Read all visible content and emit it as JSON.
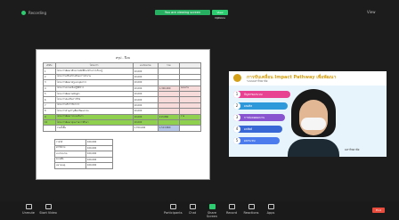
{
  "topbar": {
    "recording_label": "Recording",
    "share_banner": "You are viewing screen",
    "share_button": "View Options",
    "view_label": "View"
  },
  "document": {
    "title": "สรุป - ปีงบ",
    "headers": [
      "ลำดับ",
      "โครงการ",
      "งบประมาณ",
      "รวม",
      ""
    ],
    "rows": [
      {
        "no": "1",
        "name": "โครงการพัฒนาศักยภาพนักศึกษาด้านการเรียนรู้",
        "budget": "10,000",
        "sum": "",
        "note": ""
      },
      {
        "no": "2",
        "name": "โครงการเสริมสร้างทักษะการทำงาน",
        "budget": "10,000",
        "sum": "",
        "note": ""
      },
      {
        "no": "3",
        "name": "โครงการพัฒนาครูและบุคลากร",
        "budget": "10,000",
        "sum": "",
        "note": ""
      },
      {
        "no": "4",
        "name": "โครงการอบรมเชิงปฏิบัติการ",
        "budget": "10,000",
        "sum": "1,300,000",
        "note": "แผนงาน"
      },
      {
        "no": "5",
        "name": "โครงการพัฒนาหลักสูตร",
        "budget": "10,000",
        "sum": "",
        "note": ""
      },
      {
        "no": "6",
        "name": "โครงการส่งเสริมการวิจัย",
        "budget": "10,000",
        "sum": "",
        "note": ""
      },
      {
        "no": "7",
        "name": "โครงการบริการวิชาการ",
        "budget": "10,000",
        "sum": "",
        "note": ""
      },
      {
        "no": "8",
        "name": "โครงการทำนุบำรุงศิลปวัฒนธรรม",
        "budget": "10,000",
        "sum": "",
        "note": ""
      },
      {
        "no": "9",
        "name": "โครงการพัฒนาระบบบริหาร",
        "budget": "10,000",
        "sum": "213,860",
        "note": "รวม"
      },
      {
        "no": "10",
        "name": "โครงการพัฒนาคุณภาพการศึกษา",
        "budget": "10,000",
        "sum": "",
        "note": ""
      }
    ],
    "total_label": "รวมทั้งสิ้น",
    "total_budget": "1,700,000",
    "total_sum": "1,513,860",
    "low_rows": [
      {
        "label": "รายได้",
        "value": "100,000"
      },
      {
        "label": "ค่าใช้จ่าย",
        "value": "100,000"
      },
      {
        "label": "งบประมาณ",
        "value": "100,000"
      },
      {
        "label": "คงเหลือ",
        "value": "100,000"
      },
      {
        "label": "หมายเหตุ",
        "value": "100,000"
      }
    ]
  },
  "video": {
    "title": "การขับเคลื่อน Impact Pathway เพื่อพัฒนา",
    "subtitle": "ระบบมหาวิทยาลัย",
    "pills": [
      {
        "num": "1",
        "text": "ปัญหาของระบบ"
      },
      {
        "num": "2",
        "text": "ผลผลิต"
      },
      {
        "num": "3",
        "text": "การต่อยอดผลงาน"
      },
      {
        "num": "4",
        "text": "ผลลัพธ์"
      },
      {
        "num": "5",
        "text": "ผลกระทบ"
      }
    ],
    "footer": "มหาวิทยาลัย"
  },
  "toolbar": {
    "items": [
      "Unmute",
      "Start Video",
      "Participants",
      "Chat",
      "Share Screen",
      "Record",
      "Reactions",
      "Apps"
    ],
    "end_label": "End"
  }
}
